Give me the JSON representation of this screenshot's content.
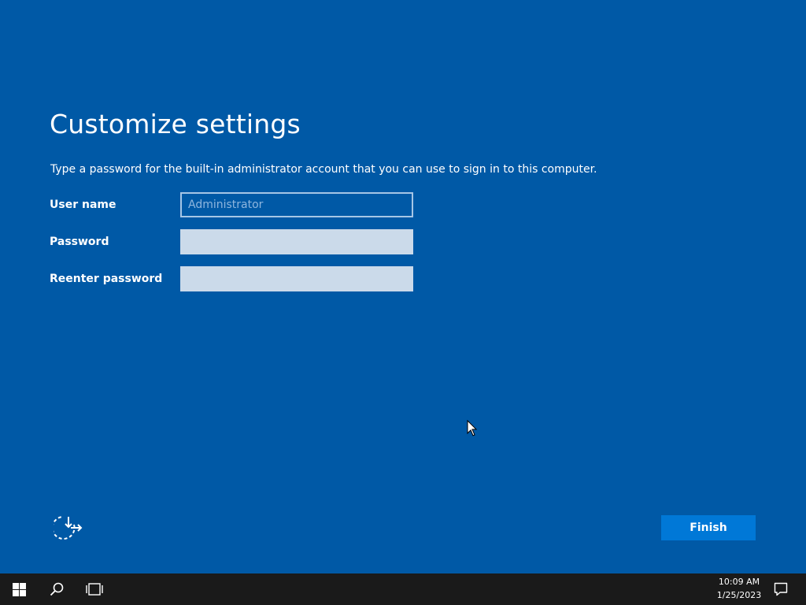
{
  "setup": {
    "title": "Customize settings",
    "instruction": "Type a password for the built-in administrator account that you can use to sign in to this computer.",
    "fields": {
      "username": {
        "label": "User name",
        "placeholder": "Administrator",
        "value": ""
      },
      "password": {
        "label": "Password",
        "value": ""
      },
      "reenter_password": {
        "label": "Reenter password",
        "value": ""
      }
    },
    "accessibility_icon": "ease-of-access-icon",
    "finish_label": "Finish"
  },
  "taskbar": {
    "icons": [
      "windows-start-icon",
      "search-icon",
      "task-view-icon",
      "notification-icon"
    ],
    "time": "10:09 AM",
    "date": "1/25/2023"
  },
  "colors": {
    "background": "#0059a6",
    "accent": "#0078d7",
    "field_fill": "#cbdaea",
    "taskbar": "#1a1a1a"
  }
}
